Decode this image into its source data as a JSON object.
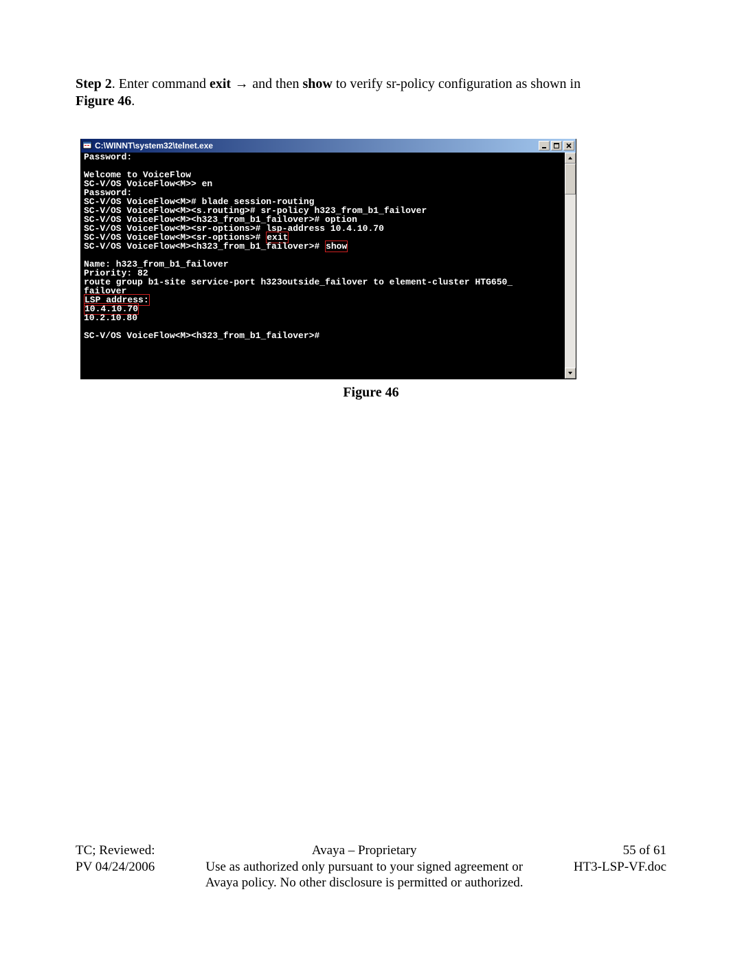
{
  "step": {
    "prefix": "Step 2",
    "sep1": ". Enter command ",
    "cmd1": "exit",
    "arrow": " → ",
    "mid": " and then ",
    "cmd2": "show",
    "rest": " to verify sr-policy configuration as shown in ",
    "figref": "Figure 46",
    "dot": "."
  },
  "window": {
    "title": "C:\\WINNT\\system32\\telnet.exe"
  },
  "term": {
    "l01": "Password:",
    "l02": "",
    "l03": "Welcome to VoiceFlow",
    "l04": "SC-V/OS VoiceFlow<M>> en",
    "l05": "Password:",
    "l06": "SC-V/OS VoiceFlow<M># blade session-routing",
    "l07": "SC-V/OS VoiceFlow<M><s.routing># sr-policy h323_from_b1_failover",
    "l08": "SC-V/OS VoiceFlow<M><h323_from_b1_failover># option",
    "l09": "SC-V/OS VoiceFlow<M><sr-options># lsp-address 10.4.10.70",
    "l10a": "SC-V/OS VoiceFlow<M><sr-options># ",
    "l10b": "exit",
    "l11a": "SC-V/OS VoiceFlow<M><h323_from_b1_failover># ",
    "l11b": "show",
    "l12": "",
    "l13": "Name: h323_from_b1_failover",
    "l14": "Priority: 82",
    "l15": "route group b1-site service-port h323outside_failover to element-cluster HTG650_",
    "l16": "failover",
    "l17": "LSP address:",
    "l18": "10.4.10.70",
    "l19": "10.2.10.80",
    "l20": "",
    "l21": "SC-V/OS VoiceFlow<M><h323_from_b1_failover>#"
  },
  "caption": "Figure 46",
  "footer": {
    "left1": "TC; Reviewed:",
    "left2": "PV 04/24/2006",
    "center1": "Avaya – Proprietary",
    "center2": "Use as authorized only pursuant to your signed agreement or",
    "center3": "Avaya policy. No other disclosure is permitted or authorized.",
    "right1": "55 of 61",
    "right2": "HT3-LSP-VF.doc"
  }
}
